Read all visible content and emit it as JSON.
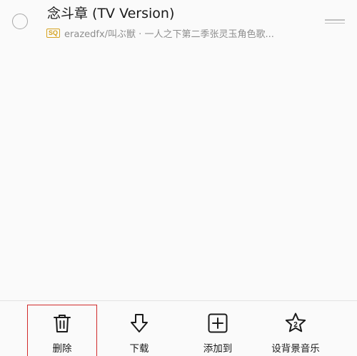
{
  "song": {
    "title": "念斗章 (TV Version)",
    "quality_badge": "SQ",
    "subtitle": "erazedfx/叫ぶ獣 · 一人之下第二季张灵玉角色歌..."
  },
  "actions": [
    {
      "label": "删除",
      "icon": "trash-icon"
    },
    {
      "label": "下载",
      "icon": "download-arrow-icon"
    },
    {
      "label": "添加到",
      "icon": "add-square-icon"
    },
    {
      "label": "设背景音乐",
      "icon": "star-2-icon"
    }
  ],
  "colors": {
    "background": "#fafafa",
    "badge_gold": "#d5a11e",
    "highlight_red": "#d12b2b",
    "text_primary": "#1b1b1b",
    "text_secondary": "#8e8e8e"
  }
}
